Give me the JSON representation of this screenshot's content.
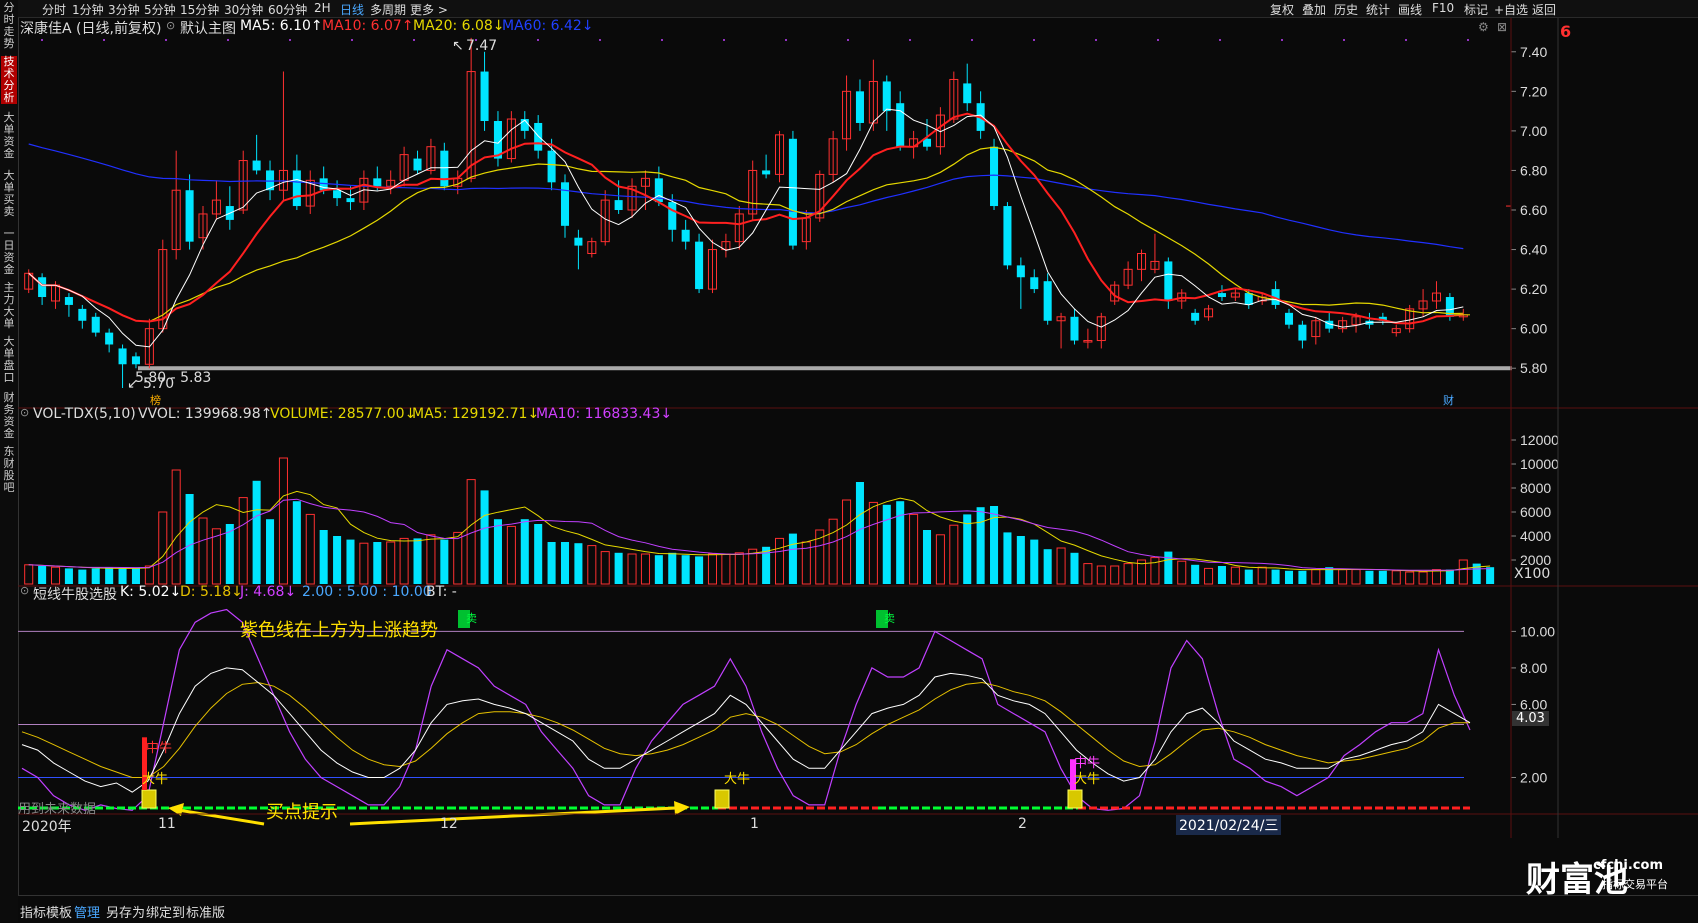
{
  "left_tabs": [
    {
      "label": "分时走势"
    },
    {
      "label": "技术分析"
    },
    {
      "label": "大单资金"
    },
    {
      "label": "大单买卖"
    },
    {
      "label": "一日资金"
    },
    {
      "label": "主力大单"
    },
    {
      "label": "大单盘口"
    },
    {
      "label": "财务资金"
    },
    {
      "label": "东财股吧"
    }
  ],
  "period_tabs": [
    {
      "label": "分时"
    },
    {
      "label": "1分钟"
    },
    {
      "label": "3分钟"
    },
    {
      "label": "5分钟"
    },
    {
      "label": "15分钟"
    },
    {
      "label": "30分钟"
    },
    {
      "label": "60分钟"
    },
    {
      "label": "2H"
    },
    {
      "label": "日线"
    },
    {
      "label": "多周期"
    },
    {
      "label": "更多 >"
    }
  ],
  "tools": [
    {
      "label": "复权"
    },
    {
      "label": "叠加"
    },
    {
      "label": "历史"
    },
    {
      "label": "统计"
    },
    {
      "label": "画线"
    },
    {
      "label": "F10"
    },
    {
      "label": "标记"
    },
    {
      "label": "+自选"
    },
    {
      "label": "返回"
    }
  ],
  "main_header": {
    "stock": "深康佳A (日线,前复权)",
    "template": "默认主图",
    "ma5": "MA5: 6.10↑",
    "ma10": "MA10: 6.07↑",
    "ma20": "MA20: 6.08↓",
    "ma60": "MA60: 6.42↓"
  },
  "main_annotations": {
    "high": "7.47",
    "low": "5.70",
    "range": "5.80 - 5.83",
    "mark1": "榜",
    "mark2": "财"
  },
  "price_axis": [
    "7.40",
    "7.20",
    "7.00",
    "6.80",
    "6.60",
    "6.40",
    "6.20",
    "6.00",
    "5.80"
  ],
  "vol_header": {
    "name": "VOL-TDX(5,10)",
    "vvol": "VVOL: 139968.98↑",
    "volume": "VOLUME: 28577.00↓",
    "ma5": "MA5: 129192.71↓",
    "ma10": "MA10: 116833.43↓"
  },
  "vol_axis": [
    "12000",
    "10000",
    "8000",
    "6000",
    "4000",
    "2000"
  ],
  "vol_unit": "X100",
  "ind_header": {
    "name": "短线牛股选股",
    "k": "K: 5.02↓",
    "d": "D: 5.18↓",
    "j": "J: 4.68↓",
    "params": "2.00 : 5.00 : 10.00",
    "bt": "BT: -"
  },
  "ind_axis": [
    "10.00",
    "8.00",
    "6.00",
    "2.00"
  ],
  "ind_current": "4.03",
  "ind_annotations": {
    "purple_note": "紫色线在上方为上涨趋势",
    "buy_hint": "买点提示",
    "future_data": "用到未来数据",
    "bull1": "大牛",
    "bull2": "大牛",
    "bull3": "大牛",
    "mid_bull": "中牛",
    "mid_bull2": "中牛",
    "sell1": "卖",
    "sell2": "卖"
  },
  "date_axis": {
    "year": "2020年",
    "m11": "11",
    "m12": "12",
    "m1": "1",
    "m2": "2",
    "cursor": "2021/02/24/三"
  },
  "bottom_tabs": [
    {
      "label": "指标"
    },
    {
      "label": "模板"
    },
    {
      "label": "管理"
    },
    {
      "label": "另存为"
    },
    {
      "label": "绑定到"
    },
    {
      "label": "标准版"
    }
  ],
  "brand": {
    "name": "财富池",
    "site": "cfchi.com",
    "tag": "指标交易平台"
  },
  "side_note": "6",
  "colors": {
    "up": "#ff3030",
    "down": "#00e5ff",
    "ma5": "#ffffff",
    "ma10": "#ff2020",
    "ma20": "#e5d800",
    "ma60": "#2030ff",
    "k": "#ffffff",
    "d": "#e5c000",
    "j": "#c040ff"
  },
  "chart_data": {
    "type": "candlestick",
    "ylim": [
      5.7,
      7.5
    ],
    "candles": [
      {
        "o": 6.2,
        "h": 6.3,
        "l": 6.18,
        "c": 6.28
      },
      {
        "o": 6.26,
        "h": 6.28,
        "l": 6.12,
        "c": 6.16
      },
      {
        "o": 6.14,
        "h": 6.24,
        "l": 6.1,
        "c": 6.22
      },
      {
        "o": 6.16,
        "h": 6.18,
        "l": 6.06,
        "c": 6.12
      },
      {
        "o": 6.1,
        "h": 6.12,
        "l": 6.0,
        "c": 6.04
      },
      {
        "o": 6.06,
        "h": 6.08,
        "l": 5.96,
        "c": 5.98
      },
      {
        "o": 5.98,
        "h": 6.0,
        "l": 5.88,
        "c": 5.92
      },
      {
        "o": 5.9,
        "h": 5.92,
        "l": 5.7,
        "c": 5.82
      },
      {
        "o": 5.86,
        "h": 5.88,
        "l": 5.8,
        "c": 5.82
      },
      {
        "o": 5.82,
        "h": 6.05,
        "l": 5.8,
        "c": 6.0
      },
      {
        "o": 6.0,
        "h": 6.45,
        "l": 5.98,
        "c": 6.4
      },
      {
        "o": 6.4,
        "h": 6.9,
        "l": 6.35,
        "c": 6.7
      },
      {
        "o": 6.7,
        "h": 6.78,
        "l": 6.4,
        "c": 6.44
      },
      {
        "o": 6.46,
        "h": 6.62,
        "l": 6.4,
        "c": 6.58
      },
      {
        "o": 6.58,
        "h": 6.75,
        "l": 6.55,
        "c": 6.65
      },
      {
        "o": 6.62,
        "h": 6.72,
        "l": 6.5,
        "c": 6.55
      },
      {
        "o": 6.6,
        "h": 6.9,
        "l": 6.58,
        "c": 6.85
      },
      {
        "o": 6.85,
        "h": 6.98,
        "l": 6.78,
        "c": 6.8
      },
      {
        "o": 6.8,
        "h": 6.85,
        "l": 6.65,
        "c": 6.7
      },
      {
        "o": 6.7,
        "h": 7.3,
        "l": 6.65,
        "c": 6.8
      },
      {
        "o": 6.8,
        "h": 6.88,
        "l": 6.6,
        "c": 6.62
      },
      {
        "o": 6.62,
        "h": 6.8,
        "l": 6.58,
        "c": 6.75
      },
      {
        "o": 6.76,
        "h": 6.82,
        "l": 6.68,
        "c": 6.7
      },
      {
        "o": 6.7,
        "h": 6.75,
        "l": 6.62,
        "c": 6.66
      },
      {
        "o": 6.66,
        "h": 6.72,
        "l": 6.6,
        "c": 6.64
      },
      {
        "o": 6.64,
        "h": 6.8,
        "l": 6.6,
        "c": 6.76
      },
      {
        "o": 6.76,
        "h": 6.82,
        "l": 6.7,
        "c": 6.72
      },
      {
        "o": 6.72,
        "h": 6.8,
        "l": 6.68,
        "c": 6.75
      },
      {
        "o": 6.75,
        "h": 6.92,
        "l": 6.72,
        "c": 6.88
      },
      {
        "o": 6.86,
        "h": 6.9,
        "l": 6.78,
        "c": 6.8
      },
      {
        "o": 6.8,
        "h": 6.96,
        "l": 6.78,
        "c": 6.92
      },
      {
        "o": 6.9,
        "h": 6.94,
        "l": 6.7,
        "c": 6.72
      },
      {
        "o": 6.72,
        "h": 6.8,
        "l": 6.68,
        "c": 6.76
      },
      {
        "o": 6.76,
        "h": 7.47,
        "l": 6.74,
        "c": 7.3
      },
      {
        "o": 7.3,
        "h": 7.4,
        "l": 7.0,
        "c": 7.05
      },
      {
        "o": 7.05,
        "h": 7.1,
        "l": 6.82,
        "c": 6.86
      },
      {
        "o": 6.86,
        "h": 7.1,
        "l": 6.84,
        "c": 7.06
      },
      {
        "o": 7.06,
        "h": 7.1,
        "l": 6.96,
        "c": 7.0
      },
      {
        "o": 7.04,
        "h": 7.08,
        "l": 6.86,
        "c": 6.9
      },
      {
        "o": 6.9,
        "h": 6.96,
        "l": 6.7,
        "c": 6.74
      },
      {
        "o": 6.74,
        "h": 6.78,
        "l": 6.46,
        "c": 6.52
      },
      {
        "o": 6.46,
        "h": 6.5,
        "l": 6.3,
        "c": 6.42
      },
      {
        "o": 6.38,
        "h": 6.46,
        "l": 6.36,
        "c": 6.44
      },
      {
        "o": 6.44,
        "h": 6.7,
        "l": 6.42,
        "c": 6.65
      },
      {
        "o": 6.65,
        "h": 6.75,
        "l": 6.58,
        "c": 6.6
      },
      {
        "o": 6.6,
        "h": 6.76,
        "l": 6.56,
        "c": 6.72
      },
      {
        "o": 6.72,
        "h": 6.8,
        "l": 6.6,
        "c": 6.76
      },
      {
        "o": 6.76,
        "h": 6.82,
        "l": 6.62,
        "c": 6.64
      },
      {
        "o": 6.64,
        "h": 6.68,
        "l": 6.44,
        "c": 6.5
      },
      {
        "o": 6.5,
        "h": 6.55,
        "l": 6.4,
        "c": 6.44
      },
      {
        "o": 6.44,
        "h": 6.48,
        "l": 6.18,
        "c": 6.2
      },
      {
        "o": 6.2,
        "h": 6.45,
        "l": 6.18,
        "c": 6.4
      },
      {
        "o": 6.4,
        "h": 6.48,
        "l": 6.36,
        "c": 6.44
      },
      {
        "o": 6.44,
        "h": 6.62,
        "l": 6.4,
        "c": 6.58
      },
      {
        "o": 6.58,
        "h": 6.85,
        "l": 6.55,
        "c": 6.8
      },
      {
        "o": 6.8,
        "h": 6.88,
        "l": 6.76,
        "c": 6.78
      },
      {
        "o": 6.78,
        "h": 7.0,
        "l": 6.74,
        "c": 6.98
      },
      {
        "o": 6.96,
        "h": 7.0,
        "l": 6.4,
        "c": 6.42
      },
      {
        "o": 6.44,
        "h": 6.6,
        "l": 6.4,
        "c": 6.56
      },
      {
        "o": 6.56,
        "h": 6.8,
        "l": 6.54,
        "c": 6.78
      },
      {
        "o": 6.78,
        "h": 7.0,
        "l": 6.74,
        "c": 6.96
      },
      {
        "o": 6.96,
        "h": 7.28,
        "l": 6.9,
        "c": 7.2
      },
      {
        "o": 7.2,
        "h": 7.26,
        "l": 7.0,
        "c": 7.04
      },
      {
        "o": 7.04,
        "h": 7.36,
        "l": 7.0,
        "c": 7.25
      },
      {
        "o": 7.25,
        "h": 7.28,
        "l": 7.0,
        "c": 7.1
      },
      {
        "o": 7.14,
        "h": 7.2,
        "l": 6.9,
        "c": 6.92
      },
      {
        "o": 6.92,
        "h": 7.0,
        "l": 6.86,
        "c": 6.96
      },
      {
        "o": 6.96,
        "h": 7.06,
        "l": 6.9,
        "c": 6.92
      },
      {
        "o": 6.92,
        "h": 7.12,
        "l": 6.88,
        "c": 7.08
      },
      {
        "o": 7.06,
        "h": 7.3,
        "l": 7.04,
        "c": 7.26
      },
      {
        "o": 7.24,
        "h": 7.34,
        "l": 7.1,
        "c": 7.14
      },
      {
        "o": 7.14,
        "h": 7.2,
        "l": 6.96,
        "c": 7.0
      },
      {
        "o": 6.92,
        "h": 6.96,
        "l": 6.6,
        "c": 6.62
      },
      {
        "o": 6.62,
        "h": 6.64,
        "l": 6.3,
        "c": 6.32
      },
      {
        "o": 6.32,
        "h": 6.36,
        "l": 6.1,
        "c": 6.26
      },
      {
        "o": 6.26,
        "h": 6.3,
        "l": 6.18,
        "c": 6.2
      },
      {
        "o": 6.24,
        "h": 6.28,
        "l": 6.02,
        "c": 6.04
      },
      {
        "o": 6.04,
        "h": 6.08,
        "l": 5.9,
        "c": 6.06
      },
      {
        "o": 6.06,
        "h": 6.1,
        "l": 5.92,
        "c": 5.94
      },
      {
        "o": 5.94,
        "h": 6.0,
        "l": 5.9,
        "c": 5.94
      },
      {
        "o": 5.94,
        "h": 6.08,
        "l": 5.9,
        "c": 6.06
      },
      {
        "o": 6.14,
        "h": 6.24,
        "l": 6.12,
        "c": 6.22
      },
      {
        "o": 6.22,
        "h": 6.34,
        "l": 6.2,
        "c": 6.3
      },
      {
        "o": 6.3,
        "h": 6.4,
        "l": 6.24,
        "c": 6.38
      },
      {
        "o": 6.3,
        "h": 6.48,
        "l": 6.28,
        "c": 6.34
      },
      {
        "o": 6.34,
        "h": 6.36,
        "l": 6.1,
        "c": 6.14
      },
      {
        "o": 6.14,
        "h": 6.2,
        "l": 6.1,
        "c": 6.18
      },
      {
        "o": 6.08,
        "h": 6.1,
        "l": 6.02,
        "c": 6.04
      },
      {
        "o": 6.06,
        "h": 6.12,
        "l": 6.04,
        "c": 6.1
      },
      {
        "o": 6.18,
        "h": 6.22,
        "l": 6.14,
        "c": 6.16
      },
      {
        "o": 6.16,
        "h": 6.2,
        "l": 6.14,
        "c": 6.18
      },
      {
        "o": 6.18,
        "h": 6.2,
        "l": 6.1,
        "c": 6.12
      },
      {
        "o": 6.14,
        "h": 6.18,
        "l": 6.12,
        "c": 6.16
      },
      {
        "o": 6.2,
        "h": 6.24,
        "l": 6.1,
        "c": 6.12
      },
      {
        "o": 6.08,
        "h": 6.1,
        "l": 6.0,
        "c": 6.02
      },
      {
        "o": 6.02,
        "h": 6.04,
        "l": 5.9,
        "c": 5.94
      },
      {
        "o": 5.96,
        "h": 6.06,
        "l": 5.92,
        "c": 6.04
      },
      {
        "o": 6.04,
        "h": 6.08,
        "l": 5.98,
        "c": 6.0
      },
      {
        "o": 6.0,
        "h": 6.06,
        "l": 5.98,
        "c": 6.04
      },
      {
        "o": 6.02,
        "h": 6.08,
        "l": 5.98,
        "c": 6.06
      },
      {
        "o": 6.04,
        "h": 6.08,
        "l": 6.0,
        "c": 6.02
      },
      {
        "o": 6.06,
        "h": 6.08,
        "l": 6.02,
        "c": 6.04
      },
      {
        "o": 5.98,
        "h": 6.02,
        "l": 5.96,
        "c": 6.0
      },
      {
        "o": 6.0,
        "h": 6.12,
        "l": 5.98,
        "c": 6.1
      },
      {
        "o": 6.1,
        "h": 6.2,
        "l": 6.06,
        "c": 6.14
      },
      {
        "o": 6.14,
        "h": 6.24,
        "l": 6.1,
        "c": 6.18
      },
      {
        "o": 6.16,
        "h": 6.18,
        "l": 6.04,
        "c": 6.06
      },
      {
        "o": 6.06,
        "h": 6.1,
        "l": 6.04,
        "c": 6.07
      }
    ],
    "volume_ylim": [
      0,
      13000
    ],
    "volume": [
      1600,
      1500,
      1400,
      1300,
      1200,
      1300,
      1400,
      1300,
      1300,
      1500,
      6000,
      9500,
      7500,
      5500,
      4600,
      5000,
      7200,
      8600,
      5400,
      10500,
      6900,
      5800,
      4500,
      4000,
      3700,
      3400,
      3500,
      3500,
      3800,
      3800,
      4100,
      3700,
      4300,
      8700,
      7800,
      5400,
      4800,
      5400,
      5000,
      3500,
      3500,
      3400,
      3200,
      2700,
      2600,
      2500,
      2500,
      2400,
      2600,
      2400,
      2300,
      2500,
      2500,
      2600,
      2900,
      3100,
      3800,
      4200,
      3500,
      4500,
      5400,
      7000,
      8500,
      6800,
      6600,
      6900,
      5800,
      4500,
      4100,
      4900,
      5800,
      6400,
      6500,
      4300,
      4000,
      3700,
      2900,
      3000,
      2600,
      1700,
      1500,
      1500,
      1700,
      2000,
      2200,
      2700,
      1900,
      1600,
      1300,
      1500,
      1400,
      1200,
      1400,
      1200,
      1100,
      1100,
      1200,
      1400,
      1200,
      1200,
      1100,
      1100,
      1100,
      1000,
      1000,
      1200,
      1200,
      2000,
      1700,
      1400
    ],
    "kdj_ylim": [
      0,
      11.5
    ],
    "k": [
      3.8,
      3.5,
      2.8,
      2.3,
      1.8,
      1.5,
      1.7,
      1.2,
      1.8,
      3.5,
      5.5,
      7.0,
      7.7,
      8.0,
      7.9,
      7.2,
      6.5,
      5.5,
      4.5,
      3.5,
      2.8,
      2.3,
      2.0,
      2.0,
      2.5,
      3.5,
      5.0,
      6.0,
      6.2,
      6.3,
      6.0,
      5.8,
      5.5,
      5.0,
      4.5,
      4.0,
      3.0,
      2.5,
      2.5,
      3.0,
      3.5,
      4.0,
      4.5,
      5.0,
      5.5,
      6.5,
      6.0,
      5.0,
      4.0,
      3.0,
      2.5,
      2.5,
      3.5,
      4.5,
      5.5,
      5.8,
      6.0,
      6.5,
      7.5,
      7.7,
      7.6,
      7.4,
      6.5,
      6.2,
      6.0,
      5.5,
      4.5,
      3.5,
      2.8,
      2.2,
      1.8,
      2.0,
      3.0,
      4.5,
      5.5,
      5.8,
      5.0,
      4.0,
      3.5,
      3.0,
      2.8,
      2.5,
      2.5,
      2.5,
      3.0,
      3.2,
      3.5,
      3.8,
      4.0,
      4.5,
      6.0,
      5.5,
      5.0
    ],
    "d": [
      4.5,
      4.2,
      3.8,
      3.4,
      3.0,
      2.6,
      2.3,
      2.0,
      2.0,
      2.6,
      3.6,
      4.8,
      5.8,
      6.6,
      7.1,
      7.2,
      7.0,
      6.5,
      5.8,
      5.0,
      4.2,
      3.5,
      3.0,
      2.7,
      2.6,
      2.9,
      3.6,
      4.4,
      5.0,
      5.5,
      5.6,
      5.6,
      5.5,
      5.3,
      5.0,
      4.6,
      4.1,
      3.6,
      3.3,
      3.2,
      3.3,
      3.5,
      3.8,
      4.2,
      4.6,
      5.3,
      5.5,
      5.3,
      4.9,
      4.3,
      3.7,
      3.3,
      3.4,
      3.8,
      4.4,
      4.9,
      5.3,
      5.7,
      6.3,
      6.8,
      7.1,
      7.2,
      7.0,
      6.7,
      6.5,
      6.2,
      5.6,
      4.9,
      4.2,
      3.5,
      2.9,
      2.6,
      2.7,
      3.3,
      4.0,
      4.6,
      4.7,
      4.5,
      4.2,
      3.8,
      3.5,
      3.2,
      3.0,
      2.8,
      2.9,
      3.0,
      3.2,
      3.4,
      3.6,
      4.0,
      4.7,
      5.0,
      5.0
    ],
    "j": [
      2.5,
      2.0,
      1.0,
      0.5,
      0.2,
      0.5,
      0.3,
      0.2,
      1.0,
      5.0,
      9.0,
      10.5,
      11.0,
      11.2,
      10.5,
      8.5,
      6.5,
      4.5,
      3.0,
      2.0,
      1.5,
      1.0,
      0.5,
      0.5,
      1.5,
      3.5,
      7.0,
      9.0,
      8.5,
      8.0,
      7.0,
      6.5,
      6.0,
      4.5,
      3.5,
      2.5,
      1.0,
      0.5,
      0.5,
      2.5,
      4.0,
      5.0,
      6.0,
      6.5,
      7.0,
      8.5,
      7.0,
      4.5,
      2.5,
      1.0,
      0.5,
      0.5,
      3.5,
      6.0,
      8.0,
      7.5,
      7.5,
      8.0,
      10.0,
      9.5,
      9.0,
      8.5,
      6.0,
      5.5,
      5.0,
      4.5,
      2.5,
      1.0,
      0.3,
      0.2,
      0.3,
      1.0,
      4.0,
      8.0,
      9.5,
      8.5,
      5.5,
      3.0,
      2.5,
      1.8,
      1.5,
      1.0,
      1.5,
      2.0,
      3.2,
      3.8,
      4.5,
      5.0,
      5.0,
      5.5,
      9.0,
      6.5,
      4.6
    ],
    "buy_points": [
      8,
      48,
      76
    ],
    "sell_points": [
      29,
      62
    ]
  }
}
